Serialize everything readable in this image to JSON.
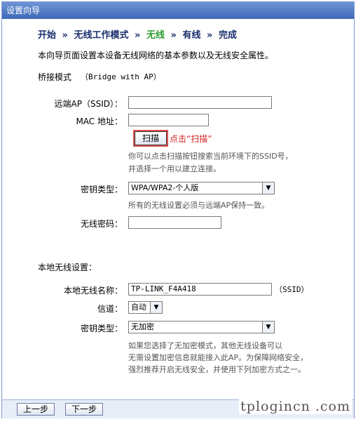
{
  "window": {
    "title": "设置向导"
  },
  "steps": {
    "items": [
      "开始",
      "无线工作模式",
      "无线",
      "有线",
      "完成"
    ],
    "separator": "»",
    "current_index": 2
  },
  "intro": "本向导页面设置本设备无线网络的基本参数以及无线安全属性。",
  "mode": {
    "label": "桥接模式",
    "value": "（Bridge with AP）"
  },
  "remote": {
    "ssid_label": "远端AP（SSID）：",
    "ssid_value": "",
    "mac_label": "MAC 地址：",
    "mac_value": "",
    "scan_button": "扫描",
    "scan_annotation": "点击“扫描”",
    "scan_hint_line1": "你可以点击扫描按钮搜索当前环境下的SSID号，",
    "scan_hint_line2": "并选择一个用以建立连接。",
    "key_type_label": "密钥类型：",
    "key_type_value": "WPA/WPA2-个人版",
    "key_hint": "所有的无线设置必须与远端AP保持一致。",
    "password_label": "无线密码：",
    "password_value": ""
  },
  "local": {
    "section_label": "本地无线设置：",
    "name_label": "本地无线名称：",
    "name_value": "TP-LINK_F4A418",
    "ssid_suffix": "（SSID）",
    "channel_label": "信道：",
    "channel_value": "自动",
    "key_type_label": "密钥类型：",
    "key_type_value": "无加密",
    "hint_line1": "如果您选择了无加密模式，其他无线设备可以",
    "hint_line2": "无需设置加密信息就能接入此AP。为保障网络安全，",
    "hint_line3": "强烈推荐开启无线安全，并使用下列加密方式之一。"
  },
  "nav": {
    "prev": "上一步",
    "next": "下一步"
  },
  "watermark": "tplogincn .com",
  "colors": {
    "titlebar": "#4f7ac6",
    "current_step": "#2f9f2f",
    "annotation": "#d02020"
  }
}
